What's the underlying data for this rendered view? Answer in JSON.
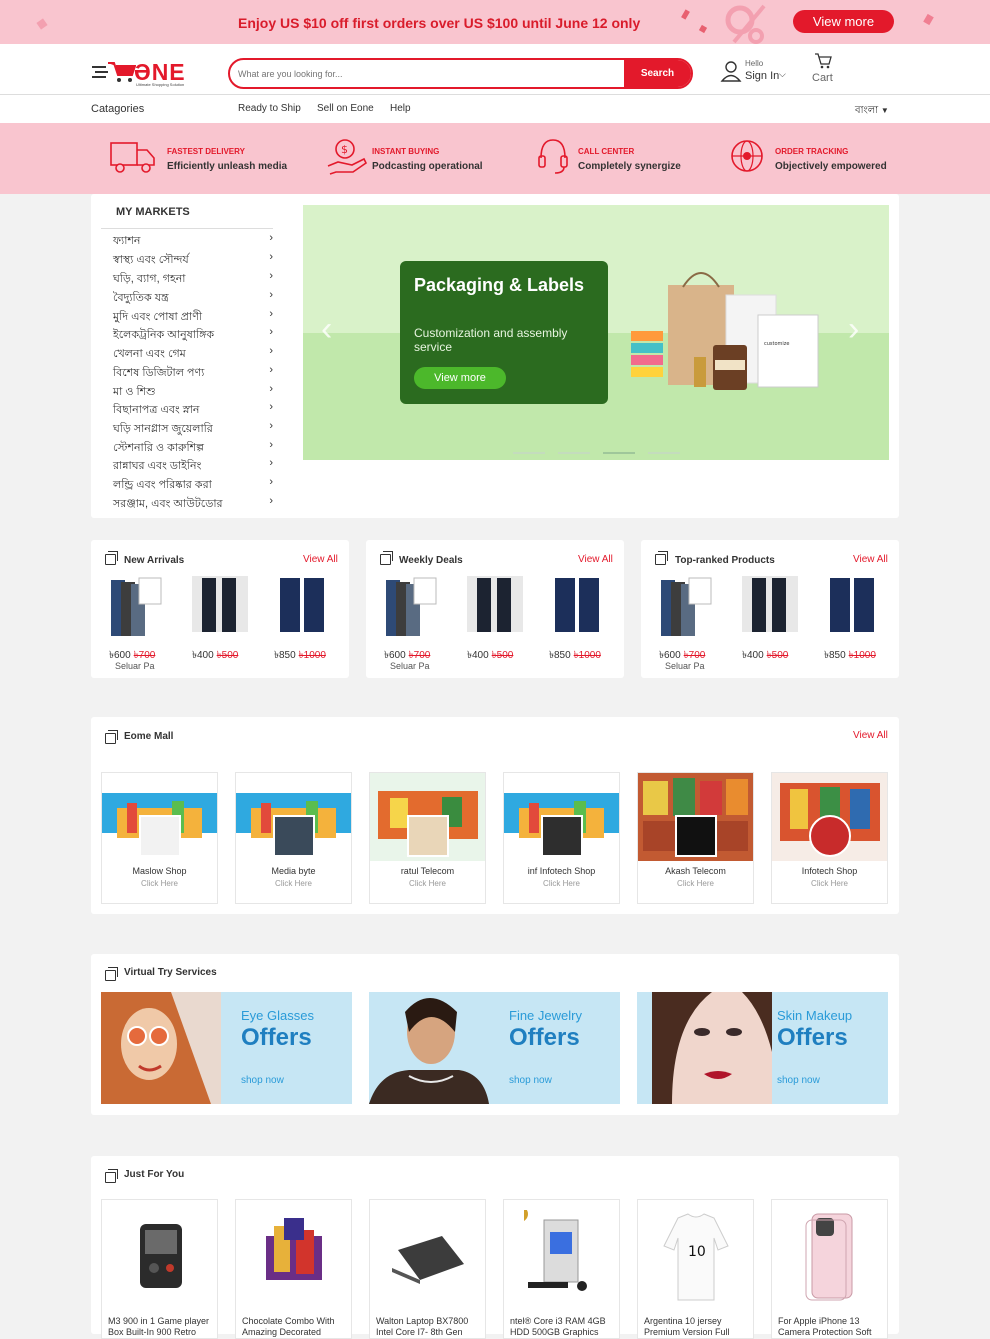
{
  "promo": {
    "text": "Enjoy US $10 off first orders over US $100 until June 12 only",
    "button": "View more"
  },
  "header": {
    "logo_word": "ƏNE",
    "logo_tagline": "Ultimate Shopping Solution",
    "search_placeholder": "What are you looking for...",
    "search_button": "Search",
    "hello": "Hello",
    "sign_in": "Sign In",
    "cart": "Cart"
  },
  "nav": {
    "categories": "Catagories",
    "links": [
      "Ready to Ship",
      "Sell on Eone",
      "Help"
    ],
    "language": "বাংলা"
  },
  "features": [
    {
      "title": "FASTEST DELIVERY",
      "subtitle": "Efficiently unleash media",
      "icon": "truck-icon"
    },
    {
      "title": "INSTANT BUYING",
      "subtitle": "Podcasting operational",
      "icon": "money-hand-icon"
    },
    {
      "title": "CALL CENTER",
      "subtitle": "Completely synergize",
      "icon": "headset-icon"
    },
    {
      "title": "ORDER TRACKING",
      "subtitle": "Objectively empowered",
      "icon": "globe-tracking-icon"
    }
  ],
  "markets": {
    "title": "MY MARKETS",
    "items": [
      "ফ্যাশন",
      "স্বাস্থ্য এবং সৌন্দর্য",
      "ঘড়ি, ব্যাগ, গহনা",
      "বৈদ্যুতিক যন্ত্র",
      "মুদি এবং পোষা প্রাণী",
      "ইলেকট্রনিক আনুষাঙ্গিক",
      "খেলনা এবং গেম",
      "বিশেষ ডিজিটাল পণ্য",
      "মা ও শিশু",
      "বিছানাপত্র এবং স্নান",
      "ঘড়ি সানগ্লাস জুয়েলারি",
      "স্টেশনারি ও কারুশিল্প",
      "রান্নাঘর এবং ডাইনিং",
      "লন্ড্রি এবং পরিষ্কার করা",
      "সরঞ্জাম, এবং আউটডোর"
    ]
  },
  "banner": {
    "heading": "Packaging & Labels",
    "subtitle": "Customization and assembly service",
    "button": "View more",
    "prev": "‹",
    "next": "›",
    "slides": 4,
    "active_slide": 3,
    "product_label": "customize"
  },
  "product_panels": [
    {
      "title": "New Arrivals",
      "view_all": "View All"
    },
    {
      "title": "Weekly Deals",
      "view_all": "View All"
    },
    {
      "title": "Top-ranked Products",
      "view_all": "View All"
    }
  ],
  "panel_products": [
    {
      "price": "৳600",
      "old": "৳700",
      "name": "Seluar Pa"
    },
    {
      "price": "৳400",
      "old": "৳500",
      "name": ""
    },
    {
      "price": "৳850",
      "old": "৳1000",
      "name": ""
    }
  ],
  "mall": {
    "title": "Eome Mall",
    "view_all": "View All",
    "shops": [
      {
        "name": "Maslow Shop",
        "cta": "Click Here"
      },
      {
        "name": "Media byte",
        "cta": "Click Here"
      },
      {
        "name": "ratul Telecom",
        "cta": "Click Here"
      },
      {
        "name": "inf Infotech Shop",
        "cta": "Click Here"
      },
      {
        "name": "Akash Telecom",
        "cta": "Click Here"
      },
      {
        "name": "Infotech Shop",
        "cta": "Click Here"
      }
    ]
  },
  "virtual": {
    "title": "Virtual Try Services",
    "cards": [
      {
        "category": "Eye Glasses",
        "offer": "Offers",
        "cta": "shop now"
      },
      {
        "category": "Fine Jewelry",
        "offer": "Offers",
        "cta": "shop now"
      },
      {
        "category": "Skin Makeup",
        "offer": "Offers",
        "cta": "shop now"
      }
    ]
  },
  "jfy": {
    "title": "Just For You",
    "items": [
      {
        "name": "M3 900 in 1 Game player Box Built-In 900 Retro"
      },
      {
        "name": "Chocolate Combo With Amazing Decorated"
      },
      {
        "name": "Walton Laptop BX7800 Intel Core I7- 8th Gen"
      },
      {
        "name": "ntel® Core i3 RAM 4GB HDD 500GB Graphics"
      },
      {
        "name": "Argentina 10 jersey Premium Version Full"
      },
      {
        "name": "For Apple iPhone 13 Camera Protection Soft"
      }
    ]
  },
  "colors": {
    "brand_red": "#e3192b",
    "pink_band": "#f9c5cf",
    "banner_green": "#2b6b1f"
  }
}
